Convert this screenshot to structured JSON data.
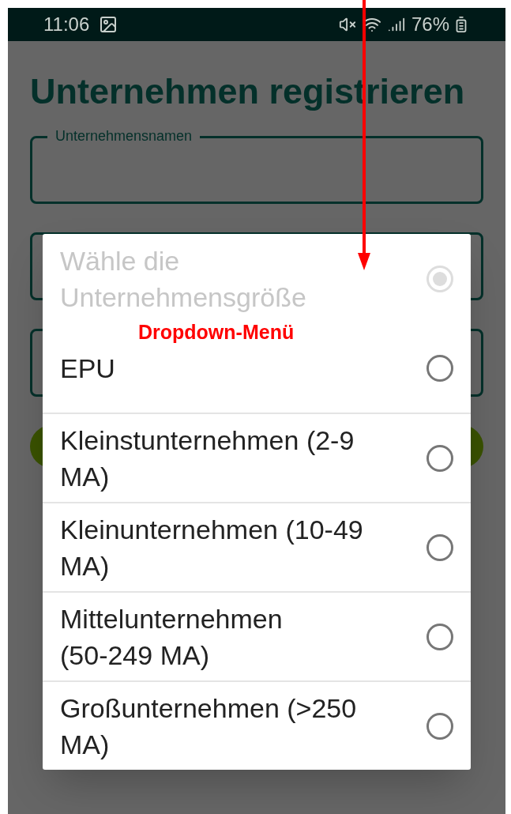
{
  "status_bar": {
    "time": "11:06",
    "battery": "76%"
  },
  "title": "Unternehmen registrieren",
  "fields": [
    {
      "label": "Unternehmensnamen"
    }
  ],
  "dropdown": {
    "options": [
      {
        "label": "Wähle die Unternehmensgröße",
        "selected": true,
        "disabled": true
      },
      {
        "label": "EPU",
        "selected": false,
        "disabled": false
      },
      {
        "label": "Kleinstunternehmen (2-9 MA)",
        "selected": false,
        "disabled": false
      },
      {
        "label": "Kleinunternehmen (10-49 MA)",
        "selected": false,
        "disabled": false
      },
      {
        "label": "Mittelunternehmen (50-249 MA)",
        "selected": false,
        "disabled": false
      },
      {
        "label": "Großunternehmen (>250 MA)",
        "selected": false,
        "disabled": false
      }
    ]
  },
  "annotation": {
    "label": "Dropdown-Menü"
  }
}
